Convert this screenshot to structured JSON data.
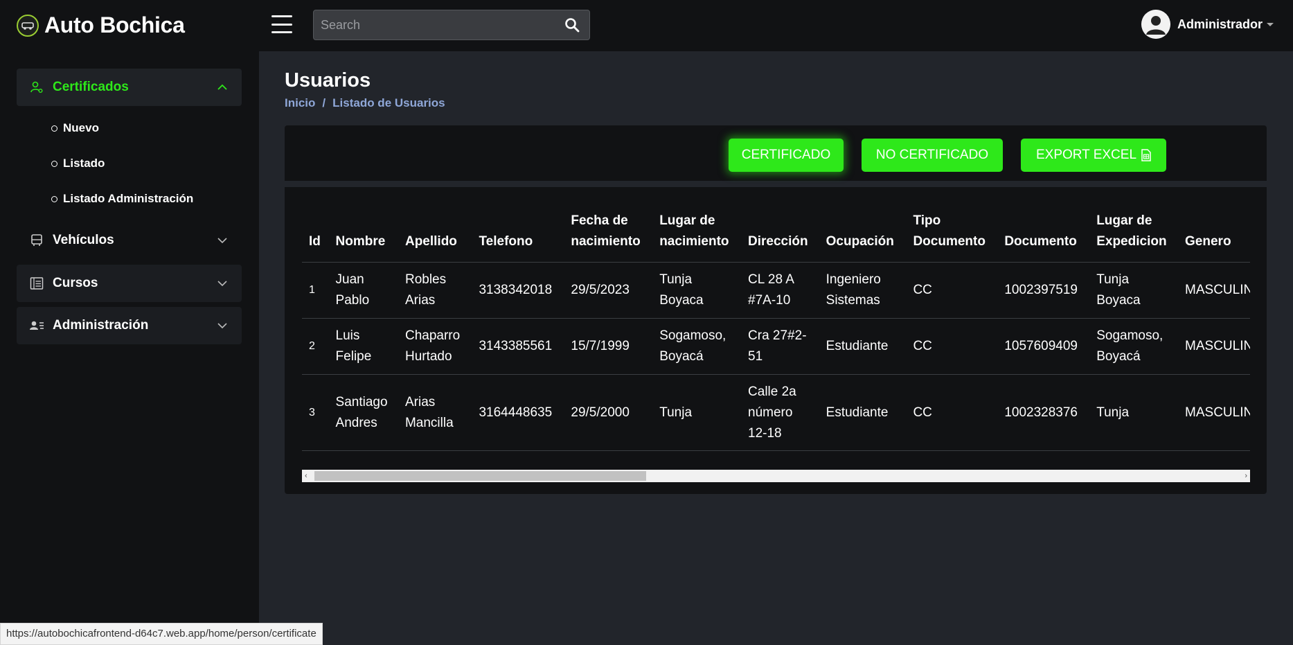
{
  "app": {
    "title": "Auto Bochica"
  },
  "search": {
    "placeholder": "Search"
  },
  "user": {
    "name": "Administrador"
  },
  "sidebar": {
    "items": [
      {
        "label": "Certificados",
        "icon": "user-certificate-icon",
        "expanded": true,
        "children": [
          {
            "label": "Nuevo"
          },
          {
            "label": "Listado"
          },
          {
            "label": "Listado Administración"
          }
        ]
      },
      {
        "label": "Vehículos",
        "icon": "bus-icon",
        "expanded": false
      },
      {
        "label": "Cursos",
        "icon": "list-icon",
        "expanded": false
      },
      {
        "label": "Administración",
        "icon": "users-list-icon",
        "expanded": false
      }
    ]
  },
  "page": {
    "title": "Usuarios",
    "breadcrumb": [
      "Inicio",
      "Listado de Usuarios"
    ]
  },
  "toolbar": {
    "buttons": [
      "CERTIFICADO",
      "NO CERTIFICADO",
      "EXPORT EXCEL"
    ]
  },
  "table": {
    "headers": [
      "Id",
      "Nombre",
      "Apellido",
      "Telefono",
      "Fecha de nacimiento",
      "Lugar de nacimiento",
      "Dirección",
      "Ocupación",
      "Tipo Documento",
      "Documento",
      "Lugar de Expedicion",
      "Genero"
    ],
    "rows": [
      [
        "1",
        "Juan Pablo",
        "Robles Arias",
        "3138342018",
        "29/5/2023",
        "Tunja Boyaca",
        "CL 28 A #7A-10",
        "Ingeniero Sistemas",
        "CC",
        "1002397519",
        "Tunja Boyaca",
        "MASCULINO"
      ],
      [
        "2",
        "Luis Felipe",
        "Chaparro Hurtado",
        "3143385561",
        "15/7/1999",
        "Sogamoso, Boyacá",
        "Cra 27#2-51",
        "Estudiante",
        "CC",
        "1057609409",
        "Sogamoso, Boyacá",
        "MASCULINO"
      ],
      [
        "3",
        "Santiago Andres",
        "Arias Mancilla",
        "3164448635",
        "29/5/2000",
        "Tunja",
        "Calle 2a número 12-18",
        "Estudiante",
        "CC",
        "1002328376",
        "Tunja",
        "MASCULINO"
      ]
    ]
  },
  "statusbar": {
    "url": "https://autobochicafrontend-d64c7.web.app/home/person/certificate"
  },
  "colors": {
    "accent": "#2ee81a",
    "sidebar_bg": "#111214",
    "content_bg": "#22252b",
    "breadcrumb": "#8fa7d8"
  }
}
